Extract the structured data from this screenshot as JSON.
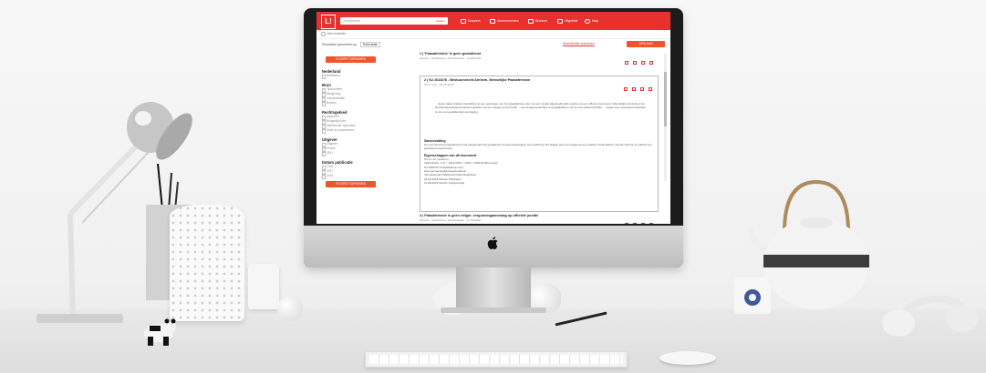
{
  "app": {
    "logo": "L!",
    "search_placeholder": "zoekopdracht",
    "search_button": "Zoeken",
    "nav": [
      "Dossiers",
      "Abonnementen",
      "Bronnen",
      "Uitgelicht",
      "Hulp"
    ],
    "home_label": "Alle resultaten",
    "filter_label": "Resultaten gesorteerd op",
    "sort_value": "Relevantie",
    "link_right": "Meer/Minder selecteren",
    "action_button": "OPSLAAN"
  },
  "sidebar": {
    "filter_button": "FILTERS TOEPASSEN",
    "groups": [
      {
        "title": "Nederland",
        "items": [
          "Nederland"
        ]
      },
      {
        "title": "Bron",
        "items": [
          "Tijdschriften",
          "Wetgeving",
          "Jurisprudentie",
          "Boeken"
        ]
      },
      {
        "title": "Rechtsgebied",
        "items": [
          "Algemeen",
          "Burgerlijk recht",
          "Intellectuele eigendom",
          "Straf- en procesrecht"
        ]
      },
      {
        "title": "Uitgever",
        "items": [
          "Uitgever",
          "Kluwer",
          "SDU"
        ]
      },
      {
        "title": "Datum publicatie",
        "items": [
          "2018",
          "2017",
          "2016"
        ]
      }
    ]
  },
  "results": [
    {
      "title": "1 | 'Paasaferisme' is geen godsdienst",
      "meta": "Nieuws - Godsdienst - Rechtspraak - 13-08-2018"
    },
    {
      "title": "2 | NJ 2018/78 - Bestuursrecht Arnhem. Menselijke Paasaferisme",
      "meta": "NJ nl L.M. - 23-02-2018"
    },
    {
      "title": "3 | Paasaferisme is geen religie: vergunningaanvraag op officiële positie",
      "meta": "Nieuws - Godsdienst - Rechtspraak - 17-08-2018"
    }
  ],
  "card": {
    "snippet": "... deels zaken hadden betrekking op een aanvrager van het paasaferisme die met een vergiet afgebeeld wilde worden op een officieel document. Uiteindelijk concludeert het Hof dat Nederlandse paspoort-pasfoto met een vergiet op het hoofd ... een kerkgenootschap of vergelijkbaar in de zin van artikel 9 EVRM. ... vergiet een essentieel onderdeel is van een godsdienstig overtuiging.",
    "summary_title": "Samenvatting",
    "summary": "Het Hof heeft het paasaferisme niet aangemerkt als godsdienst of levensovertuiging. Het verbod op het dragen van een vergiet op een pasfoto wordt daarom niet als inbreuk op vrijheid van godsdienst beschouwd.",
    "props_title": "Eigenschappen van dit document",
    "props": [
      "NJ nl L.M. (Auteurs)",
      "Tijdschriften > NJ > 2018-2020 > 2018 > 2018/78 (Bron-pad)",
      "NJ 2018/78 (Vindplaatsnummer)",
      "Heel gemeenteelijk (Geannoteerd)",
      "Internationaal Publiekrecht (Rechtsgebied)",
      "23-02-2018 (Datum Publicatie)",
      "13-08-2018 (Datum Toegevoegd)"
    ]
  },
  "colors": {
    "brand": "#e8312f",
    "accent": "#f0542c"
  },
  "icons": [
    "folder-icon",
    "bell-icon",
    "book-icon",
    "star-icon",
    "help-icon",
    "home-icon",
    "apple-logo-icon"
  ]
}
